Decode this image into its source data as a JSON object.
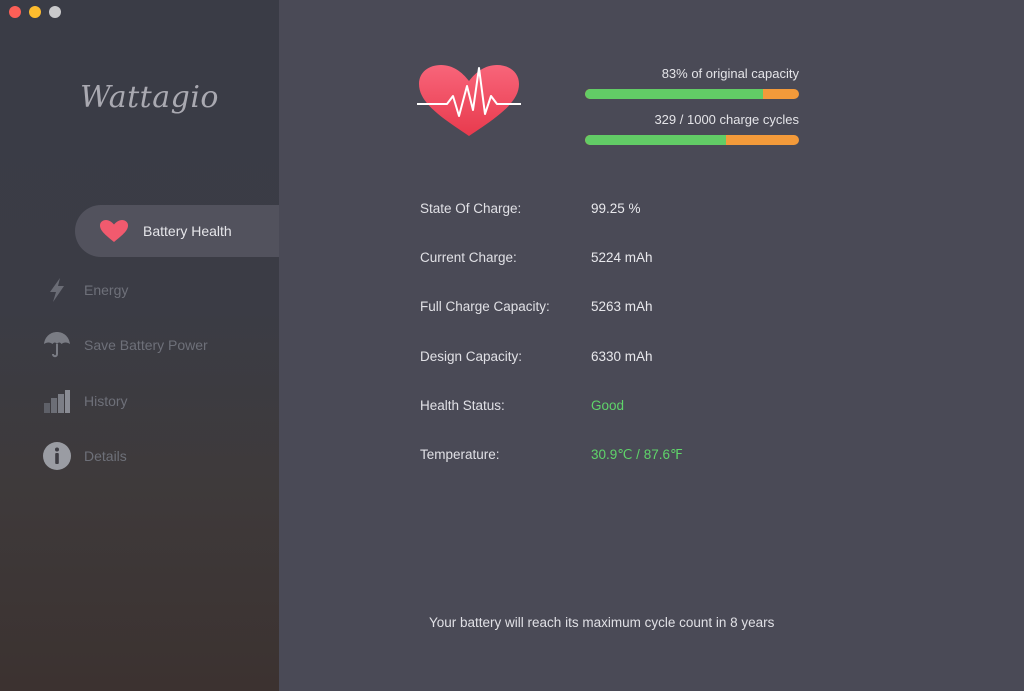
{
  "window": {
    "traffic_lights": [
      "close",
      "minimize",
      "zoom"
    ]
  },
  "sidebar": {
    "logo": "Wattagio",
    "items": [
      {
        "label": "Battery Health",
        "icon": "heart-icon",
        "active": true
      },
      {
        "label": "Energy",
        "icon": "lightning-icon",
        "active": false
      },
      {
        "label": "Save Battery Power",
        "icon": "umbrella-icon",
        "active": false
      },
      {
        "label": "History",
        "icon": "bar-chart-icon",
        "active": false
      },
      {
        "label": "Details",
        "icon": "info-icon",
        "active": false
      }
    ]
  },
  "main": {
    "capacity": {
      "label": "83% of original capacity",
      "percent": 83
    },
    "cycles": {
      "label": "329 / 1000 charge cycles",
      "percent": 66
    },
    "rows": [
      {
        "key": "State Of Charge:",
        "value": "99.25 %"
      },
      {
        "key": "Current Charge:",
        "value": "5224 mAh"
      },
      {
        "key": "Full Charge Capacity:",
        "value": "5263 mAh"
      },
      {
        "key": "Design Capacity:",
        "value": "6330 mAh"
      },
      {
        "key": "Health Status:",
        "value": "Good"
      },
      {
        "key": "Temperature:",
        "value": "30.9℃ / 87.6℉"
      }
    ],
    "footer": "Your battery will reach its maximum cycle count in 8 years"
  },
  "colors": {
    "accent_green": "#5fd46a",
    "bar_orange": "#f39a3a",
    "heart_red": "#f04a5a"
  }
}
